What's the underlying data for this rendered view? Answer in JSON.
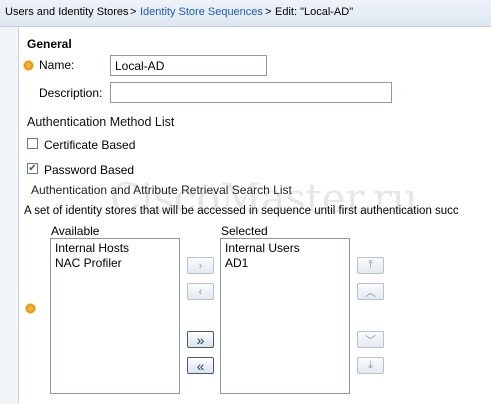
{
  "breadcrumb": {
    "root": "Users and Identity Stores",
    "sep1": ">",
    "link": "Identity Store Sequences",
    "sep2": ">",
    "current": "Edit: \"Local-AD\""
  },
  "general": {
    "heading": "General",
    "name_label": "Name:",
    "name_value": "Local-AD",
    "description_label": "Description:",
    "description_value": ""
  },
  "auth_method": {
    "heading": "Authentication Method List",
    "certificate_label": "Certificate Based",
    "certificate_checked": false,
    "password_label": "Password Based",
    "password_checked": true
  },
  "search_list": {
    "heading": "Authentication and Attribute Retrieval Search List",
    "description": "A set of identity stores that will be accessed in sequence until first authentication succ",
    "available_label": "Available",
    "available_items": [
      "Internal Hosts",
      "NAC Profiler"
    ],
    "selected_label": "Selected",
    "selected_items": [
      "Internal Users",
      "AD1"
    ]
  },
  "buttons": {
    "move_right": "›",
    "move_left": "‹",
    "move_all_right": "»",
    "move_all_left": "«",
    "move_top": "⤒",
    "move_up": "︿",
    "move_down": "﹀",
    "move_bottom": "⤓"
  },
  "watermark": "CiscoMaster.ru",
  "colors": {
    "link": "#1a5fb4",
    "required_star": "#e07b0a",
    "check": "#2a7a2a"
  }
}
